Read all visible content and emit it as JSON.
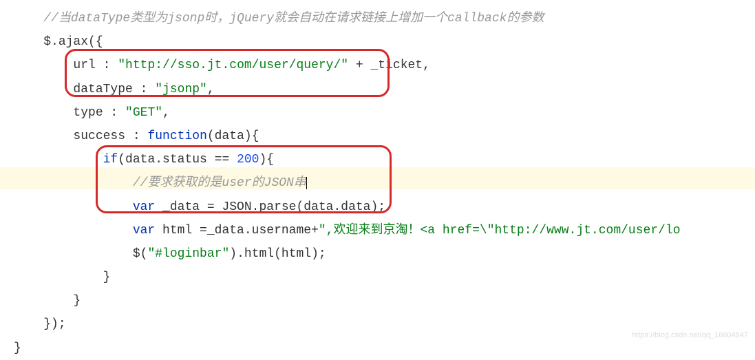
{
  "code": {
    "line1_comment": "//当dataType类型为jsonp时，jQuery就会自动在请求链接上增加一个callback的参数",
    "line2_ajax": "$.ajax({",
    "line3_url_key": "url : ",
    "line3_url_val": "\"http://sso.jt.com/user/query/\"",
    "line3_url_plus": " + _ticket,",
    "line4_dt_key": "dataType : ",
    "line4_dt_val": "\"jsonp\"",
    "line4_comma": ",",
    "line5_type_key": "type : ",
    "line5_type_val": "\"GET\"",
    "line5_comma": ",",
    "line6_success": "success : ",
    "line6_func": "function",
    "line6_args": "(data){",
    "line7_if": "if",
    "line7_cond1": "(data.status == ",
    "line7_num": "200",
    "line7_cond2": "){",
    "line8_comment": "//要求获取的是user的JSON串",
    "line9_var": "var",
    "line9_text": " _data = JSON.parse(data.data);",
    "line10_var": "var",
    "line10_text1": " html =_data.username+",
    "line10_string": "\",欢迎来到京淘！<a href=\\\"http://www.jt.com/user/lo",
    "line11_jq": "$(",
    "line11_sel": "\"#loginbar\"",
    "line11_meth": ").html(html);",
    "line12_brace": "}",
    "line13_brace": "}",
    "line14_close": "});",
    "line15_brace": "}"
  },
  "watermark": "https://blog.csdn.net/qq_16804847"
}
